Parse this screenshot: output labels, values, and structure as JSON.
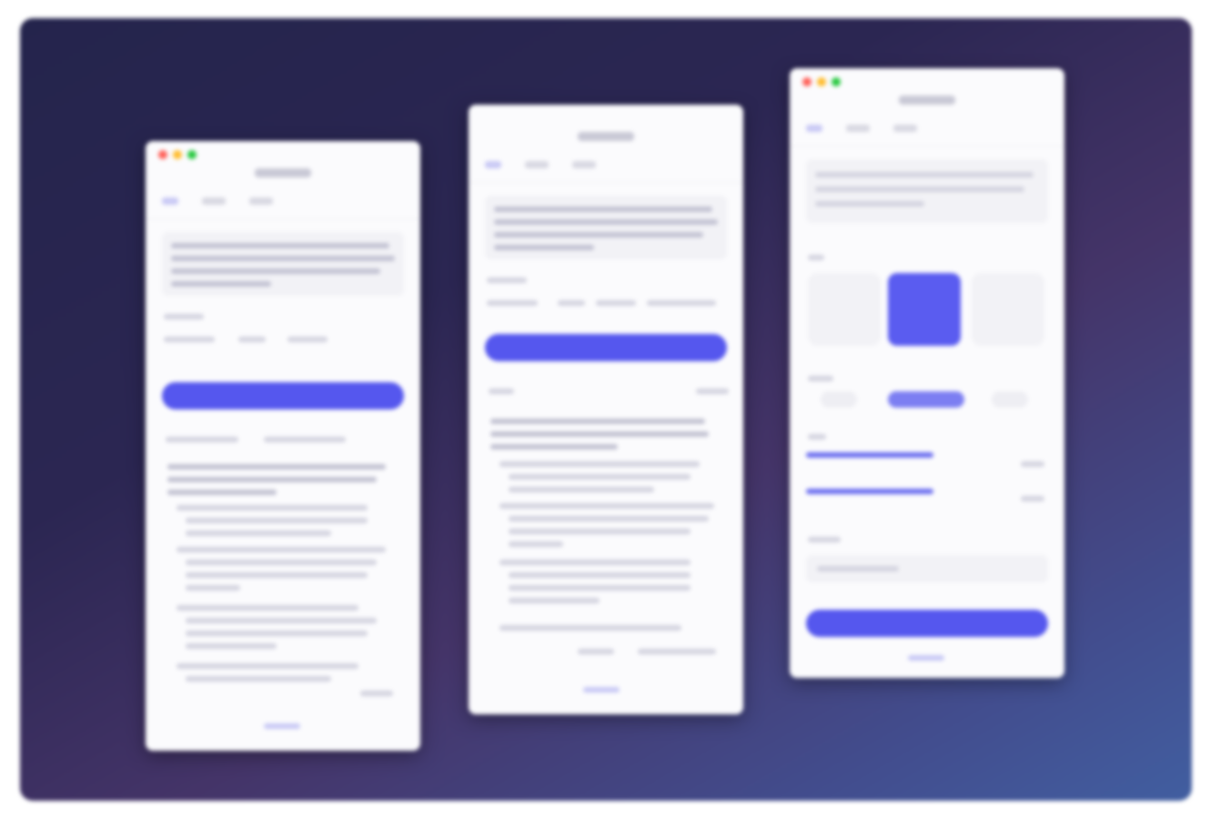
{
  "colors": {
    "background_start": "#24244c",
    "background_mid": "#443468",
    "background_end": "#415ea0",
    "accent": "#5557ee",
    "window": "#fbfbfd",
    "traffic_red": "#ff6159",
    "traffic_yellow": "#ffbd2e",
    "traffic_green": "#28c941"
  },
  "windows": [
    {
      "view": "results-list"
    },
    {
      "view": "results-summary"
    },
    {
      "view": "settings"
    }
  ]
}
